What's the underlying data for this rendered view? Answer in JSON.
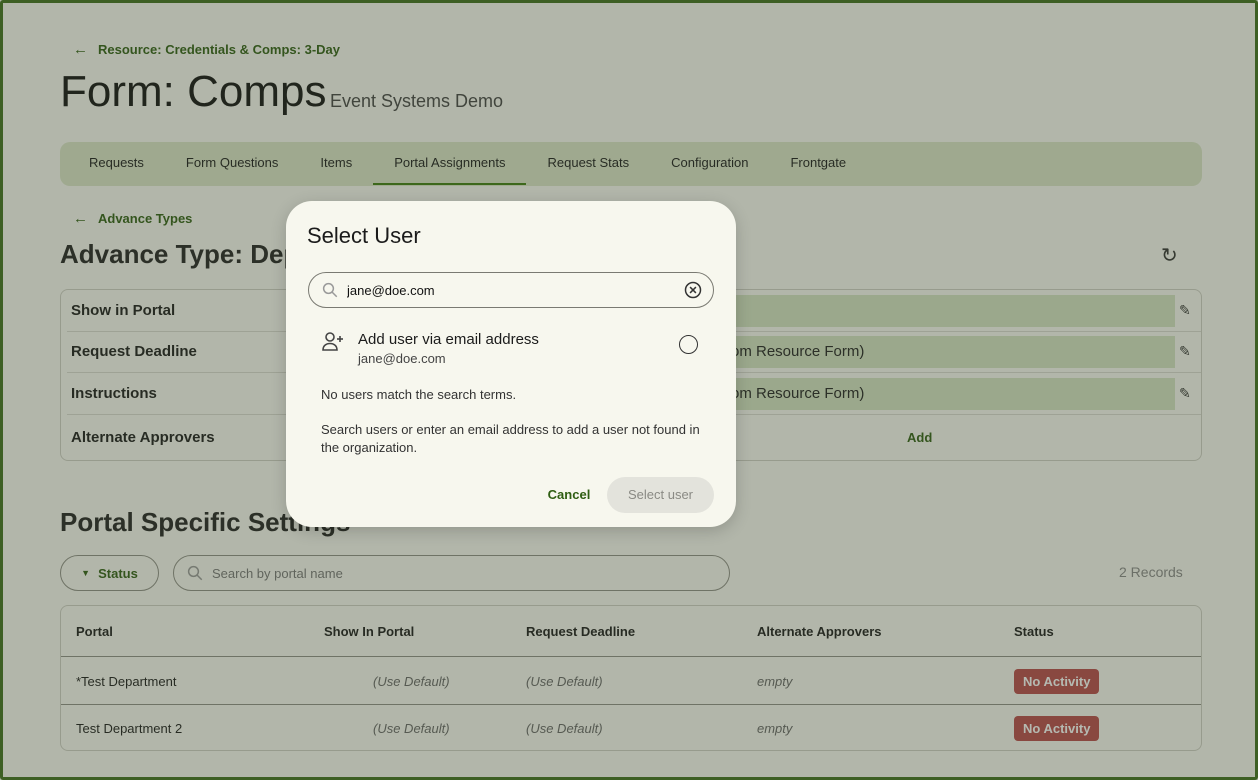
{
  "breadcrumb": {
    "label": "Resource: Credentials & Comps: 3-Day"
  },
  "page": {
    "title": "Form: Comps",
    "subtitle": "Event Systems Demo"
  },
  "tabs": [
    {
      "label": "Requests"
    },
    {
      "label": "Form Questions"
    },
    {
      "label": "Items"
    },
    {
      "label": "Portal Assignments",
      "active": true
    },
    {
      "label": "Request Stats"
    },
    {
      "label": "Configuration"
    },
    {
      "label": "Frontgate"
    }
  ],
  "sub_breadcrumb": {
    "label": "Advance Types"
  },
  "advance_type": {
    "title": "Advance Type: Depar",
    "rows": [
      {
        "label": "Show in Portal",
        "value": ""
      },
      {
        "label": "Request Deadline",
        "value": "om Resource Form)"
      },
      {
        "label": "Instructions",
        "value": "om Resource Form)"
      },
      {
        "label": "Alternate Approvers",
        "action": "Add"
      }
    ]
  },
  "portal_settings": {
    "title": "Portal Specific Settings",
    "filter_label": "Status",
    "search_placeholder": "Search by portal name",
    "records": "2 Records",
    "columns": [
      "Portal",
      "Show In Portal",
      "Request Deadline",
      "Alternate Approvers",
      "Status"
    ],
    "rows": [
      {
        "portal": "*Test Department",
        "show": "(Use Default)",
        "deadline": "(Use Default)",
        "approvers": "empty",
        "status": "No Activity"
      },
      {
        "portal": "Test Department 2",
        "show": "(Use Default)",
        "deadline": "(Use Default)",
        "approvers": "empty",
        "status": "No Activity"
      }
    ]
  },
  "dialog": {
    "title": "Select User",
    "search_value": "jane@doe.com",
    "add_user_label": "Add user via email address",
    "add_user_email": "jane@doe.com",
    "no_match": "No users match the search terms.",
    "hint": "Search users or enter an email address to add a user not found in the organization.",
    "cancel_label": "Cancel",
    "select_label": "Select user"
  },
  "colors": {
    "accent": "#2f5e12",
    "tab_bg": "#dbe6c9",
    "badge": "#b94a4a"
  }
}
